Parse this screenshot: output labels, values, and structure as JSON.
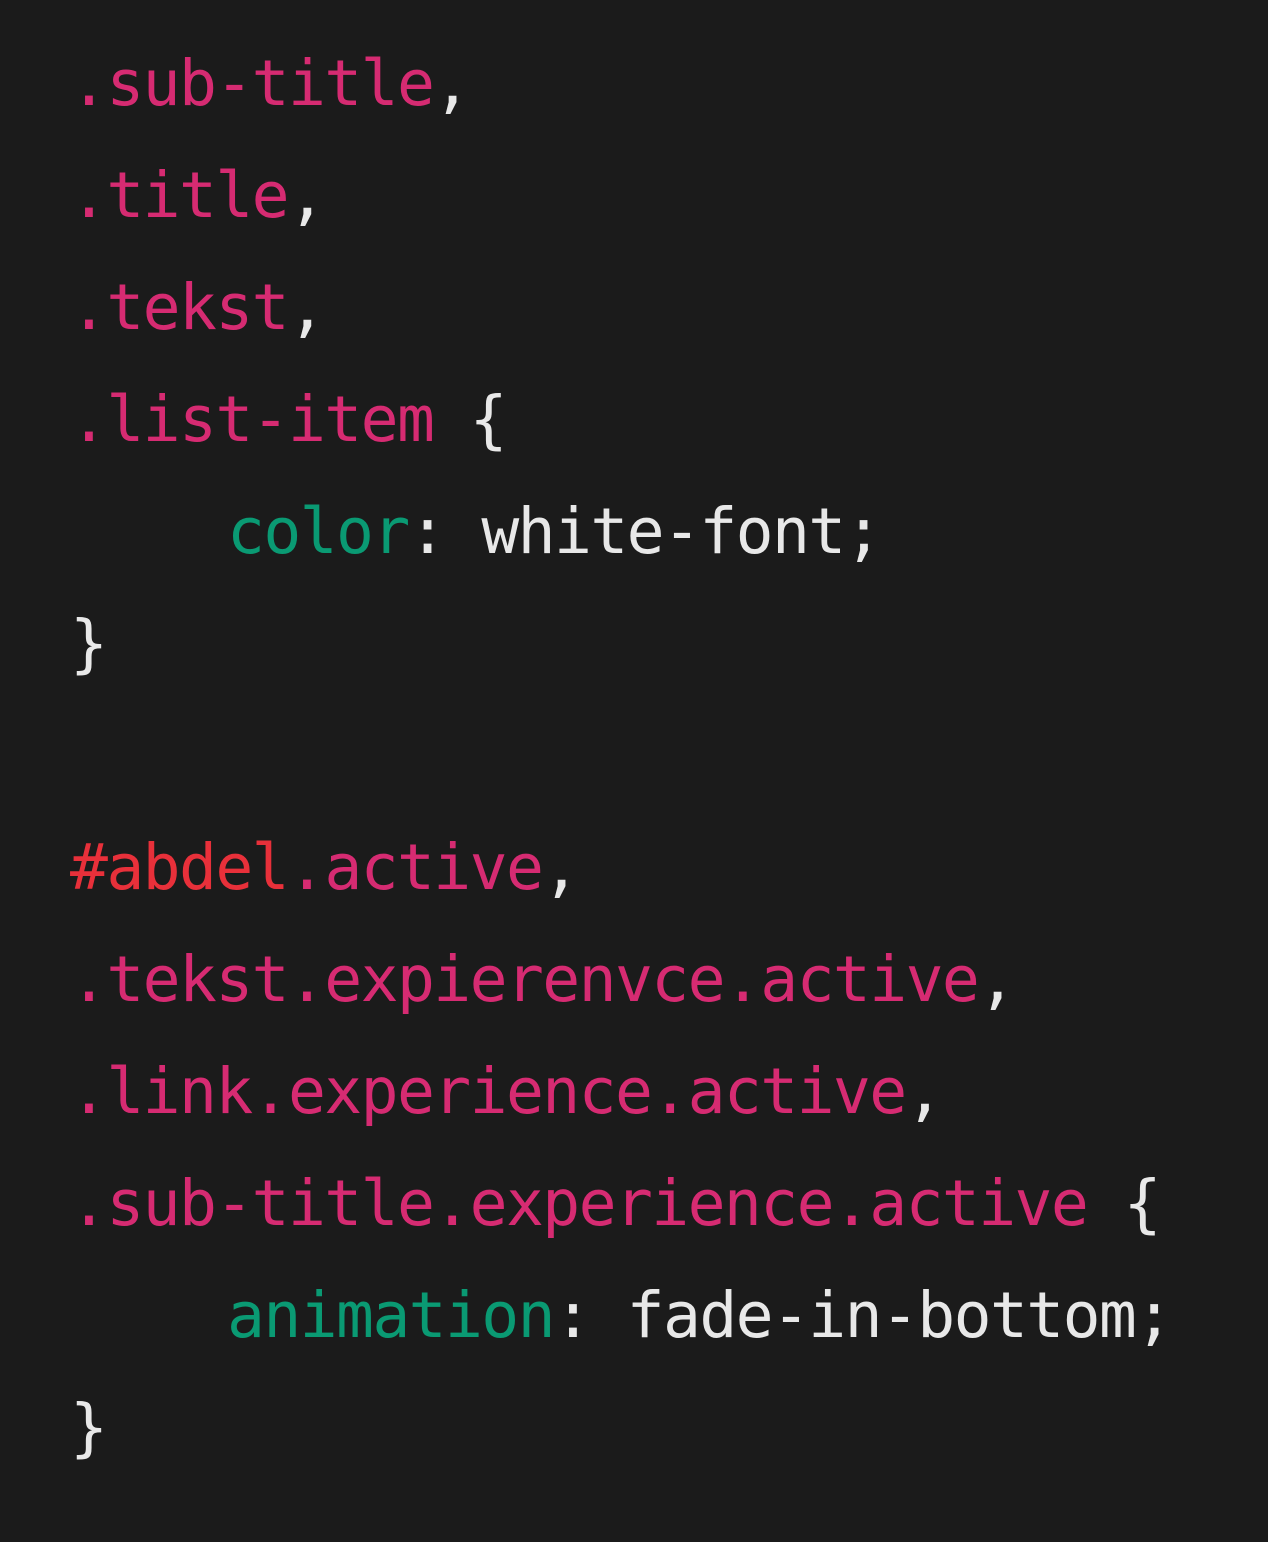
{
  "colors": {
    "background": "#1b1b1b",
    "selector": "#d62b72",
    "id_selector": "#e8303a",
    "property": "#0a9a73",
    "punctuation": "#e8e8e8"
  },
  "code": {
    "rule1": {
      "selectors": [
        ".sub-title",
        ".title",
        ".tekst",
        ".list-item"
      ],
      "comma": ",",
      "open_brace": "{",
      "property": "color",
      "colon": ":",
      "value": "white-font;",
      "close_brace": "}"
    },
    "rule2": {
      "id_selector": "#abdel",
      "selector1_class": ".active",
      "selectors": [
        ".tekst.expierenvce.active",
        ".link.experience.active",
        ".sub-title.experience.active"
      ],
      "comma": ",",
      "open_brace": "{",
      "property": "animation",
      "colon": ":",
      "value": "fade-in-bottom;",
      "close_brace": "}"
    }
  }
}
